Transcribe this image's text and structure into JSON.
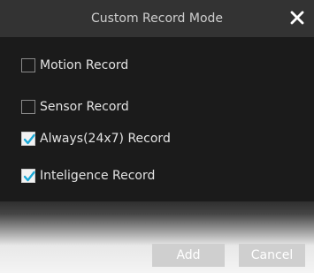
{
  "dialog": {
    "title": "Custom Record Mode",
    "close_icon": "close-icon"
  },
  "options": [
    {
      "label": "Motion Record",
      "checked": false
    },
    {
      "label": "Sensor Record",
      "checked": false
    },
    {
      "label": "Always(24x7) Record",
      "checked": true
    },
    {
      "label": "Inteligence Record",
      "checked": true
    }
  ],
  "buttons": {
    "add_label": "Add",
    "cancel_label": "Cancel"
  },
  "colors": {
    "check_accent": "#1aa8d6",
    "panel_background": "#1b1b1b",
    "titlebar_background": "#333333"
  }
}
